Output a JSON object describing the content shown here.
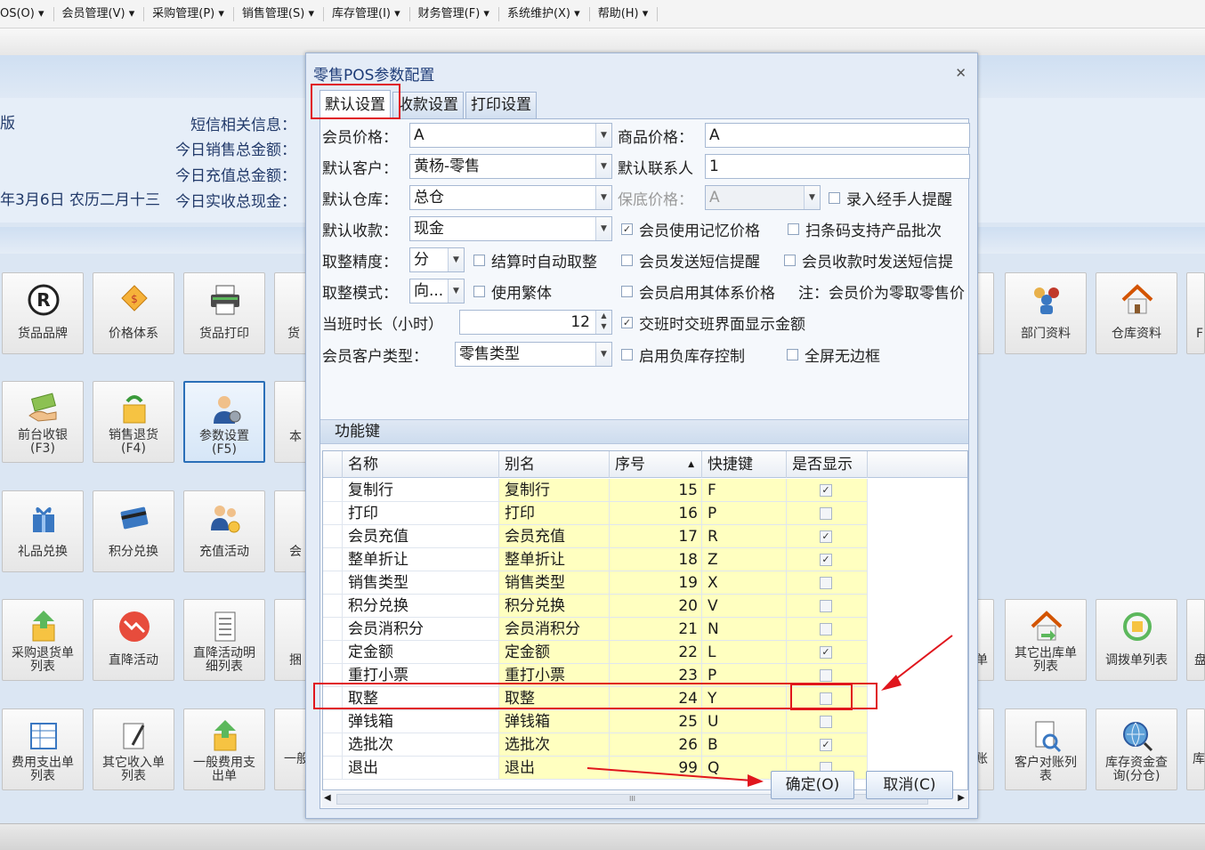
{
  "menubar": {
    "items": [
      "OS(O)",
      "会员管理(V)",
      "采购管理(P)",
      "销售管理(S)",
      "库存管理(I)",
      "财务管理(F)",
      "系统维护(X)",
      "帮助(H)"
    ]
  },
  "info": {
    "left_fragment": "版",
    "sms_label": "短信相关信息：",
    "sales_label": "今日销售总金额：",
    "recharge_label": "今日充值总金额：",
    "date_text": "年3月6日 农历二月十三",
    "cash_label": "今日实收总现金："
  },
  "tiles": {
    "row1": [
      "货品品牌",
      "价格体系",
      "货品打印",
      "货",
      "部门资料",
      "仓库资料",
      "F"
    ],
    "row2": [
      "前台收银",
      "(F3)",
      "销售退货",
      "(F4)",
      "参数设置",
      "(F5)",
      "本"
    ],
    "row3": [
      "礼品兑换",
      "积分兑换",
      "充值活动",
      "会"
    ],
    "row4": [
      "采购退货单",
      "列表",
      "直降活动",
      "直降活动明",
      "细列表",
      "捆",
      "单",
      "其它出库单",
      "列表",
      "调拨单列表",
      "盘"
    ],
    "row5": [
      "费用支出单",
      "列表",
      "其它收入单",
      "列表",
      "一般费用支",
      "出单",
      "一般",
      "账",
      "客户对账列",
      "表",
      "库存资金查",
      "询(分仓)",
      "库"
    ]
  },
  "dialog": {
    "title": "零售POS参数配置",
    "close": "✕",
    "tabs": [
      "默认设置",
      "收款设置",
      "打印设置"
    ],
    "form": {
      "member_price_label": "会员价格：",
      "member_price_value": "A",
      "product_price_label": "商品价格：",
      "product_price_value": "A",
      "default_customer_label": "默认客户：",
      "default_customer_value": "黄杨-零售",
      "default_contact_label": "默认联系人",
      "default_contact_value": "1",
      "default_warehouse_label": "默认仓库：",
      "default_warehouse_value": "总仓",
      "floor_price_label": "保底价格：",
      "floor_price_value": "A",
      "handler_reminder_label": "录入经手人提醒",
      "default_payment_label": "默认收款：",
      "default_payment_value": "现金",
      "member_memory_price_label": "会员使用记忆价格",
      "barcode_batch_label": "扫条码支持产品批次",
      "rounding_precision_label": "取整精度：",
      "rounding_precision_value": "分",
      "auto_round_label": "结算时自动取整",
      "member_sms_label": "会员发送短信提醒",
      "member_receipt_sms_label": "会员收款时发送短信提",
      "rounding_mode_label": "取整模式：",
      "rounding_mode_value": "向...",
      "traditional_label": "使用繁体",
      "member_other_price_label": "会员启用其体系价格",
      "note_text": "注：会员价为零取零售价",
      "shift_duration_label": "当班时长（小时）",
      "shift_duration_value": "12",
      "shift_amount_label": "交班时交班界面显示金额",
      "member_customer_type_label": "会员客户类型：",
      "member_customer_type_value": "零售类型",
      "negative_stock_label": "启用负库存控制",
      "fullscreen_label": "全屏无边框"
    },
    "checkboxes": {
      "handler_reminder": false,
      "member_memory_price": true,
      "barcode_batch": false,
      "auto_round": false,
      "member_sms": false,
      "member_receipt_sms": false,
      "traditional": false,
      "member_other_price": false,
      "shift_amount": true,
      "negative_stock": false,
      "fullscreen": false
    },
    "function_keys_label": "功能键",
    "grid_headers": [
      "名称",
      "别名",
      "序号",
      "快捷键",
      "是否显示"
    ],
    "sort_indicator": "▲",
    "rows": [
      {
        "name": "复制行",
        "alias": "复制行",
        "seq": "15",
        "key": "F",
        "show": true
      },
      {
        "name": "打印",
        "alias": "打印",
        "seq": "16",
        "key": "P",
        "show": false
      },
      {
        "name": "会员充值",
        "alias": "会员充值",
        "seq": "17",
        "key": "R",
        "show": true
      },
      {
        "name": "整单折让",
        "alias": "整单折让",
        "seq": "18",
        "key": "Z",
        "show": true
      },
      {
        "name": "销售类型",
        "alias": "销售类型",
        "seq": "19",
        "key": "X",
        "show": false
      },
      {
        "name": "积分兑换",
        "alias": "积分兑换",
        "seq": "20",
        "key": "V",
        "show": false
      },
      {
        "name": "会员消积分",
        "alias": "会员消积分",
        "seq": "21",
        "key": "N",
        "show": false
      },
      {
        "name": "定金额",
        "alias": "定金额",
        "seq": "22",
        "key": "L",
        "show": true
      },
      {
        "name": "重打小票",
        "alias": "重打小票",
        "seq": "23",
        "key": "P",
        "show": false
      },
      {
        "name": "取整",
        "alias": "取整",
        "seq": "24",
        "key": "Y",
        "show": false
      },
      {
        "name": "弹钱箱",
        "alias": "弹钱箱",
        "seq": "25",
        "key": "U",
        "show": false
      },
      {
        "name": "选批次",
        "alias": "选批次",
        "seq": "26",
        "key": "B",
        "show": true
      },
      {
        "name": "退出",
        "alias": "退出",
        "seq": "99",
        "key": "Q",
        "show": false
      }
    ],
    "scroll_grip": "III",
    "ok_button": "确定(O)",
    "cancel_button": "取消(C)"
  },
  "colors": {
    "highlight_red": "#e0161d",
    "row_yellow": "#ffffc0",
    "selected_tile_border": "#2a6fb8"
  }
}
